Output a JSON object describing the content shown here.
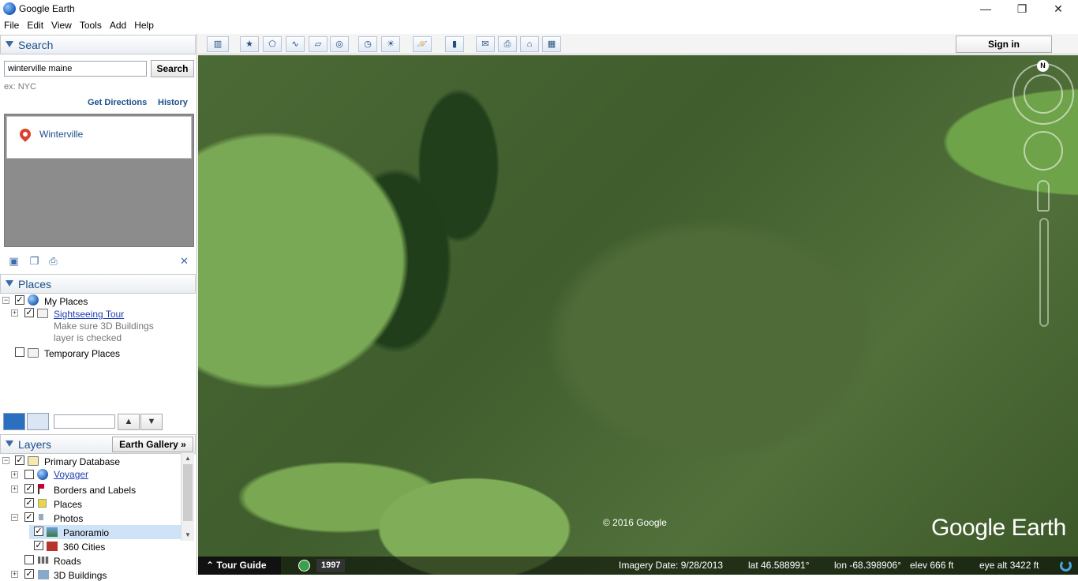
{
  "window": {
    "title": "Google Earth",
    "minimize": "—",
    "maximize": "❐",
    "close": "✕"
  },
  "menu": [
    "File",
    "Edit",
    "View",
    "Tools",
    "Add",
    "Help"
  ],
  "search": {
    "header": "Search",
    "query": "winterville maine",
    "button": "Search",
    "hint": "ex: NYC",
    "get_directions": "Get Directions",
    "history": "History",
    "result": "Winterville"
  },
  "places": {
    "header": "Places",
    "my_places": "My Places",
    "sightseeing_tour": "Sightseeing Tour",
    "note_line1": "Make sure 3D Buildings",
    "note_line2": "layer is checked",
    "temporary_places": "Temporary Places"
  },
  "layers": {
    "header": "Layers",
    "earth_gallery": "Earth Gallery »",
    "items": [
      {
        "label": "Primary Database",
        "checked": true
      },
      {
        "label": "Voyager",
        "checked": false
      },
      {
        "label": "Borders and Labels",
        "checked": true
      },
      {
        "label": "Places",
        "checked": true
      },
      {
        "label": "Photos",
        "checked": true
      },
      {
        "label": "Panoramio",
        "checked": true
      },
      {
        "label": "360 Cities",
        "checked": true
      },
      {
        "label": "Roads",
        "checked": false
      },
      {
        "label": "3D Buildings",
        "checked": true
      }
    ]
  },
  "toolbar": {
    "sign_in": "Sign in"
  },
  "map": {
    "copyright": "© 2016 Google",
    "logo": "Google Earth",
    "north": "N"
  },
  "status": {
    "tour_guide": "Tour Guide",
    "year": "1997",
    "imagery_date": "Imagery Date: 9/28/2013",
    "lat": "lat   46.588991°",
    "lon": "lon  -68.398906°",
    "elev": "elev   666 ft",
    "eye_alt": "eye alt   3422 ft"
  }
}
